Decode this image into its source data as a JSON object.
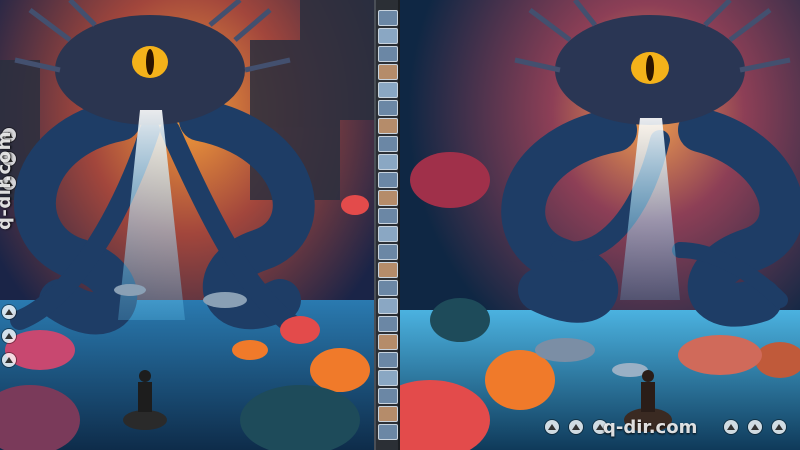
{
  "watermark": {
    "text": "q-dir.com"
  },
  "filmstrip": {
    "count": 24
  },
  "colors": {
    "deep_sea": "#0f2744",
    "sky_glow": "#f08a34",
    "creature_blue": "#1e3d66",
    "eye": "#f4b21a",
    "water_light": "#6fd6ff",
    "coral_red": "#e34b4b",
    "coral_orange": "#f07a2a"
  }
}
